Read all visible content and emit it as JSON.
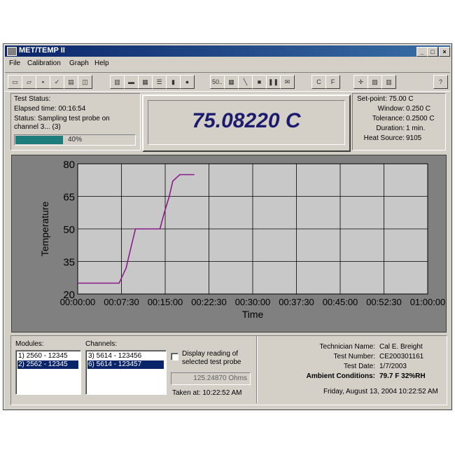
{
  "window": {
    "title": "MET/TEMP II",
    "minimize": "_",
    "maximize": "□",
    "close": "×"
  },
  "menu": [
    "File",
    "Calibration",
    "Graph",
    "Help"
  ],
  "toolbar": {
    "buttons": [
      "new",
      "open",
      "save",
      "check",
      "print",
      "preview",
      "module",
      "card",
      "printer",
      "list",
      "tool",
      "stop-circle",
      "50..",
      "grid",
      "probe",
      "stop",
      "pause",
      "envelope",
      "C",
      "F",
      "crosshair",
      "chart",
      "meter",
      "?"
    ],
    "zoom_label": "50..",
    "c_label": "C",
    "f_label": "F",
    "help_label": "?"
  },
  "test_status": {
    "heading": "Test Status:",
    "elapsed": "Elapsed time:   00:16:54",
    "status_line1": "Status:  Sampling test probe on",
    "status_line2": "channel 3...   (3)",
    "progress_value": 40,
    "progress_label": "40%"
  },
  "reading": {
    "value": "75.08220 C"
  },
  "setpoint": {
    "heading": "Set-point:  75.00 C",
    "rows": [
      {
        "label": "Window:",
        "value": "0.250 C"
      },
      {
        "label": "Tolerance:",
        "value": "0.2500 C"
      },
      {
        "label": "Duration:",
        "value": "1 min."
      },
      {
        "label": "Heat Source:",
        "value": "9105"
      }
    ]
  },
  "chart_data": {
    "type": "line",
    "xlabel": "Time",
    "ylabel": "Temperature",
    "ylim": [
      20,
      80
    ],
    "yticks": [
      "80",
      "65",
      "50",
      "35",
      "20"
    ],
    "xticks": [
      "00:00:00",
      "00:07:30",
      "00:15:00",
      "00:22:30",
      "00:30:00",
      "00:37:30",
      "00:45:00",
      "00:52:30",
      "01:00:00"
    ],
    "x_minutes": [
      0,
      7.1,
      8.3,
      9.0,
      9.9,
      14.1,
      14.8,
      15.7,
      16.3,
      17.5,
      18.0,
      20.0
    ],
    "values": [
      25,
      25,
      32,
      40,
      50,
      50,
      57,
      65,
      72,
      75,
      75,
      75
    ],
    "xlim_minutes": [
      0,
      60
    ],
    "grid": true,
    "series_color": "#8b1a8b"
  },
  "modules": {
    "heading": "Modules:",
    "items": [
      "1) 2560 - 12345",
      "2) 2562 - 12345"
    ],
    "selected": 1
  },
  "channels": {
    "heading": "Channels:",
    "items": [
      "3) 5614 - 123456",
      "6) 5614 - 123457"
    ],
    "selected": 1
  },
  "display_reading": {
    "checkbox_label_1": "Display reading of",
    "checkbox_label_2": "selected test probe",
    "value": "125.24870 Ohms",
    "taken_at": "Taken at:  10:22:52 AM"
  },
  "info": {
    "technician_label": "Technician Name:",
    "technician": "Cal E. Breight",
    "test_number_label": "Test Number:",
    "test_number": "CE200301161",
    "test_date_label": "Test Date:",
    "test_date": "1/7/2003",
    "ambient_label": "Ambient Conditions:",
    "ambient": "79.7 F   32%RH",
    "datetime": "Friday, August 13, 2004   10:22:52 AM"
  }
}
